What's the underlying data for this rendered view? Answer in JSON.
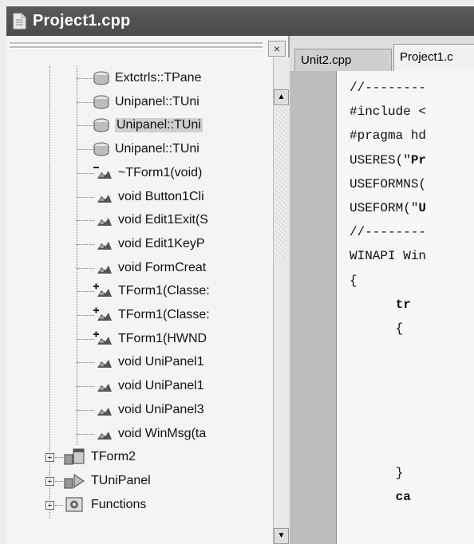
{
  "window": {
    "title": "Project1.cpp"
  },
  "tree": {
    "close_glyph": "×",
    "items": [
      {
        "label": "Extctrls::TPane",
        "icon": "class-member-icon"
      },
      {
        "label": "Unipanel::TUni",
        "icon": "class-member-icon"
      },
      {
        "label": "Unipanel::TUni",
        "icon": "class-member-icon",
        "selected": true
      },
      {
        "label": "Unipanel::TUni",
        "icon": "class-member-icon"
      },
      {
        "label": "~TForm1(void)",
        "icon": "destructor-icon"
      },
      {
        "label": "void Button1Cli",
        "icon": "method-icon"
      },
      {
        "label": "void Edit1Exit(S",
        "icon": "method-icon"
      },
      {
        "label": "void Edit1KeyP",
        "icon": "method-icon"
      },
      {
        "label": "void FormCreat",
        "icon": "method-icon"
      },
      {
        "label": "TForm1(Classe:",
        "icon": "constructor-icon"
      },
      {
        "label": "TForm1(Classe:",
        "icon": "constructor-icon"
      },
      {
        "label": "TForm1(HWND",
        "icon": "constructor-icon"
      },
      {
        "label": "void UniPanel1",
        "icon": "method-icon"
      },
      {
        "label": "void UniPanel1",
        "icon": "method-icon"
      },
      {
        "label": "void UniPanel3",
        "icon": "method-icon"
      },
      {
        "label": "void WinMsg(ta",
        "icon": "method-icon"
      }
    ],
    "roots": [
      {
        "label": "TForm2",
        "icon": "form-class-icon",
        "expander": "+"
      },
      {
        "label": "TUniPanel",
        "icon": "component-class-icon",
        "expander": "+"
      },
      {
        "label": "Functions",
        "icon": "functions-folder-icon",
        "expander": "+"
      }
    ],
    "scroll_up": "▲",
    "scroll_down": "▼"
  },
  "editor": {
    "tabs": [
      {
        "label": "Unit2.cpp",
        "active": false
      },
      {
        "label": "Project1.c",
        "active": true
      }
    ],
    "lines": [
      {
        "pre": "//--------",
        "bold": "",
        "post": ""
      },
      {
        "pre": "#include <",
        "bold": "",
        "post": ""
      },
      {
        "pre": "#pragma hd",
        "bold": "",
        "post": ""
      },
      {
        "pre": "USERES(\"",
        "bold": "Pr",
        "post": ""
      },
      {
        "pre": "USEFORMNS(",
        "bold": "",
        "post": ""
      },
      {
        "pre": "USEFORM(\"",
        "bold": "U",
        "post": ""
      },
      {
        "pre": "//--------",
        "bold": "",
        "post": ""
      },
      {
        "pre": "WINAPI Win",
        "bold": "",
        "post": ""
      },
      {
        "pre": "{",
        "bold": "",
        "post": ""
      },
      {
        "pre": "      ",
        "bold": "tr",
        "post": ""
      },
      {
        "pre": "      {",
        "bold": "",
        "post": ""
      },
      {
        "pre": "",
        "bold": "",
        "post": ""
      },
      {
        "pre": "",
        "bold": "",
        "post": ""
      },
      {
        "pre": "",
        "bold": "",
        "post": ""
      },
      {
        "pre": "",
        "bold": "",
        "post": ""
      },
      {
        "pre": "",
        "bold": "",
        "post": ""
      },
      {
        "pre": "      }",
        "bold": "",
        "post": ""
      },
      {
        "pre": "      ",
        "bold": "ca",
        "post": ""
      }
    ]
  }
}
